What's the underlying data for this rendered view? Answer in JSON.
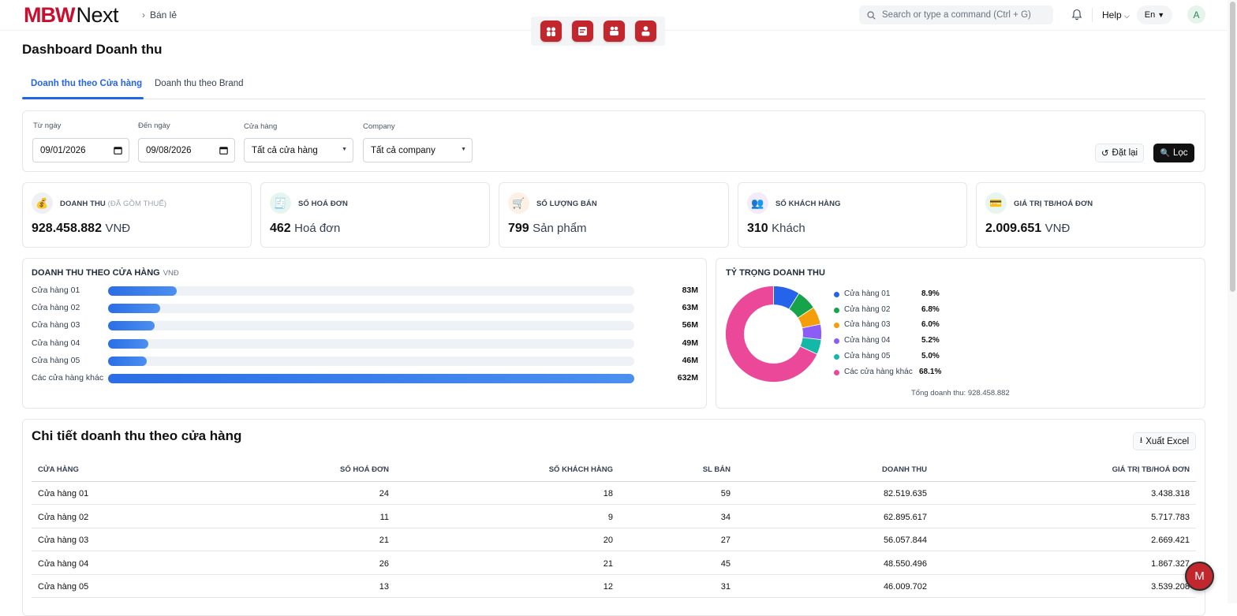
{
  "header": {
    "logo_mbw": "MBW",
    "logo_next": "Next",
    "breadcrumb": "Bán lẻ",
    "search_placeholder": "Search or type a command (Ctrl + G)",
    "help_label": "Help",
    "lang_label": "En",
    "avatar_initial": "A",
    "app_icons": [
      "app-icon-1",
      "app-icon-2",
      "app-icon-3",
      "app-icon-4"
    ]
  },
  "page": {
    "title": "Dashboard Doanh thu",
    "tabs": [
      "Doanh thu theo Cửa hàng",
      "Doanh thu theo Brand"
    ],
    "active_tab": 0
  },
  "filters": {
    "from_label": "Từ ngày",
    "from_value": "09/01/2026",
    "to_label": "Đến ngày",
    "to_value": "09/08/2026",
    "store_label": "Cửa hàng",
    "store_value": "Tất cả cửa hàng",
    "company_label": "Company",
    "company_value": "Tất cả company",
    "reset_label": "Đặt lại",
    "filter_label": "Lọc"
  },
  "kpis": [
    {
      "label": "DOANH THU",
      "sub": "(ĐÃ GỒM THUẾ)",
      "value": "928.458.882",
      "unit": "VNĐ",
      "icon": "money-bag-icon",
      "bg": "#eef0f3"
    },
    {
      "label": "SỐ HOÁ ĐƠN",
      "sub": "",
      "value": "462",
      "unit": "Hoá đơn",
      "icon": "receipt-icon",
      "bg": "#e6f6ee"
    },
    {
      "label": "SỐ LƯỢNG BÁN",
      "sub": "",
      "value": "799",
      "unit": "Sản phẩm",
      "icon": "cart-icon",
      "bg": "#fdf0e4"
    },
    {
      "label": "SỐ KHÁCH HÀNG",
      "sub": "",
      "value": "310",
      "unit": "Khách",
      "icon": "people-icon",
      "bg": "#f1ebfb"
    },
    {
      "label": "GIÁ TRỊ TB/HOÁ ĐƠN",
      "sub": "",
      "value": "2.009.651",
      "unit": "VNĐ",
      "icon": "credit-card-icon",
      "bg": "#e6f6ee"
    }
  ],
  "bar_section": {
    "title": "DOANH THU THEO CỬA HÀNG",
    "unit": "VNĐ"
  },
  "donut_section": {
    "title": "TỶ TRỌNG DOANH THU",
    "total": "Tổng doanh thu: 928.458.882"
  },
  "chart_data": [
    {
      "type": "bar",
      "orientation": "horizontal",
      "categories": [
        "Cửa hàng 01",
        "Cửa hàng 02",
        "Cửa hàng 03",
        "Cửa hàng 04",
        "Cửa hàng 05",
        "Các cửa hàng khác"
      ],
      "values": [
        82.5,
        62.9,
        56.1,
        48.6,
        46.0,
        632.4
      ],
      "value_labels": [
        "83M",
        "63M",
        "56M",
        "49M",
        "46M",
        "632M"
      ],
      "xlim": [
        0,
        632.4
      ],
      "unit": "M VNĐ"
    },
    {
      "type": "pie",
      "donut": true,
      "categories": [
        "Cửa hàng 01",
        "Cửa hàng 02",
        "Cửa hàng 03",
        "Cửa hàng 04",
        "Cửa hàng 05",
        "Các cửa hàng khác"
      ],
      "values": [
        8.9,
        6.8,
        6.0,
        5.2,
        5.0,
        68.1
      ],
      "value_labels": [
        "8.9%",
        "6.8%",
        "6.0%",
        "5.2%",
        "5.0%",
        "68.1%"
      ],
      "colors": [
        "#2563eb",
        "#16a34a",
        "#f59e0b",
        "#8b5cf6",
        "#14b8a6",
        "#ec4899"
      ],
      "legend": "right"
    }
  ],
  "table": {
    "title": "Chi tiết doanh thu theo cửa hàng",
    "export_label": "Xuất Excel",
    "columns": [
      "CỬA HÀNG",
      "SỐ HOÁ ĐƠN",
      "SỐ KHÁCH HÀNG",
      "SL BÁN",
      "DOANH THU",
      "GIÁ TRỊ TB/HOÁ ĐƠN"
    ],
    "rows": [
      [
        "Cửa hàng 01",
        "24",
        "18",
        "59",
        "82.519.635",
        "3.438.318"
      ],
      [
        "Cửa hàng 02",
        "11",
        "9",
        "34",
        "62.895.617",
        "5.717.783"
      ],
      [
        "Cửa hàng 03",
        "21",
        "20",
        "27",
        "56.057.844",
        "2.669.421"
      ],
      [
        "Cửa hàng 04",
        "26",
        "21",
        "45",
        "48.550.496",
        "1.867.327"
      ],
      [
        "Cửa hàng 05",
        "13",
        "12",
        "31",
        "46.009.702",
        "3.539.208"
      ]
    ]
  },
  "fab_label": "M"
}
